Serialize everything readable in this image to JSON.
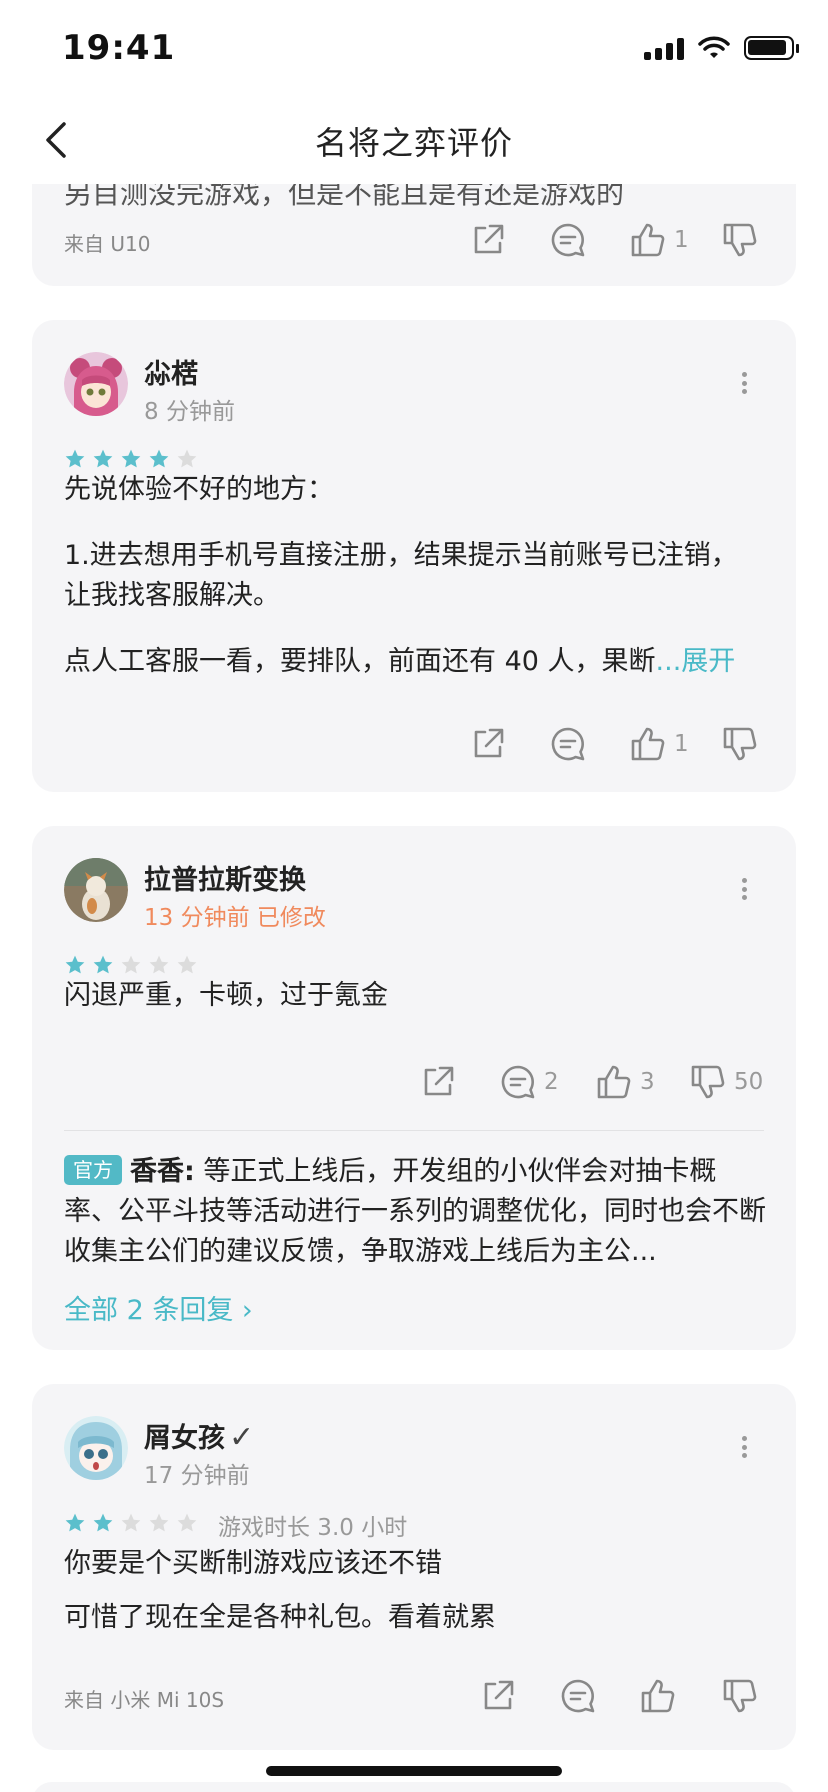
{
  "status": {
    "time": "19:41"
  },
  "nav": {
    "title": "名将之弈评价"
  },
  "reviews": [
    {
      "peek_text": "另目测没完游戏，但是不能且是有还是游戏的",
      "device": "来自 U10",
      "likes": "1"
    },
    {
      "user": "尛楛",
      "time": "8 分钟前",
      "rating": 4,
      "paragraphs": [
        "先说体验不好的地方：",
        "1.进去想用手机号直接注册，结果提示当前账号已注销，让我找客服解决。",
        "点人工客服一看，要排队，前面还有 40 人，果断"
      ],
      "expand": "...展开",
      "likes": "1"
    },
    {
      "user": "拉普拉斯变换",
      "time": "13 分钟前 已修改",
      "rating": 2,
      "text": "闪退严重，卡顿，过于氪金",
      "comments": "2",
      "likes": "3",
      "dislikes": "50",
      "reply": {
        "badge": "官方",
        "author": "香香:",
        "text": "等正式上线后，开发组的小伙伴会对抽卡概率、公平斗技等活动进行一系列的调整优化，同时也会不断收集主公们的建议反馈，争取游戏上线后为主公..."
      },
      "all_replies": "全部 2 条回复 ›"
    },
    {
      "user": "屑女孩",
      "verified": "✓",
      "time": "17 分钟前",
      "rating": 2,
      "play_time": "游戏时长 3.0 小时",
      "paragraphs": [
        "你要是个买断制游戏应该还不错",
        "可惜了现在全是各种礼包。看着就累"
      ],
      "device": "来自 小米 Mi 10S"
    }
  ],
  "colors": {
    "accent": "#49b9c7",
    "star_on": "#5bbfcc",
    "star_off": "#dcdcdc",
    "card_bg": "#f5f5f7",
    "edited": "#f08a5d"
  }
}
